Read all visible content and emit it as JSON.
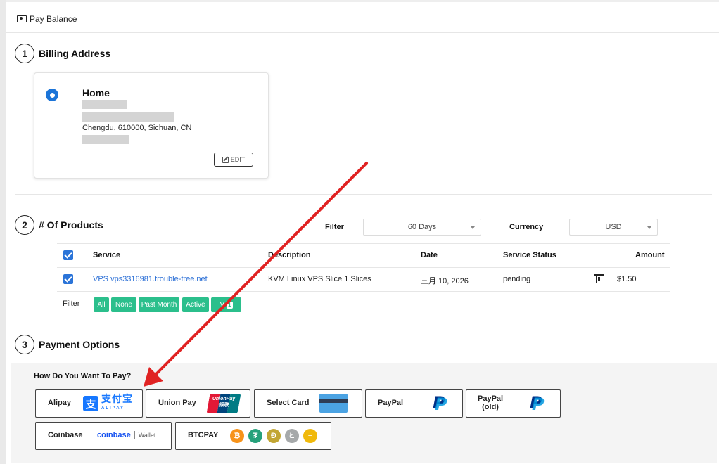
{
  "header": {
    "title": "Pay Balance",
    "icon": "money-icon"
  },
  "sections": {
    "billing": {
      "number": "1",
      "title": "Billing Address"
    },
    "products": {
      "number": "2",
      "title": "# Of Products"
    },
    "payment": {
      "number": "3",
      "title": "Payment Options"
    }
  },
  "address": {
    "name": "Home",
    "city_line": "Chengdu, 610000, Sichuan, CN",
    "edit_label": "EDIT",
    "selected": true
  },
  "filters": {
    "filter_label": "Filter",
    "filter_value": "60 Days",
    "currency_label": "Currency",
    "currency_value": "USD"
  },
  "table": {
    "columns": [
      "Service",
      "Description",
      "Date",
      "Service Status",
      "Amount"
    ],
    "rows": [
      {
        "checked": true,
        "service": "VPS vps3316981.trouble-free.net",
        "description": "KVM Linux VPS Slice 1 Slices",
        "date": "三月 10, 2026",
        "status": "pending",
        "amount": "$1.50"
      }
    ]
  },
  "row_filter": {
    "label": "Filter",
    "chips": [
      "All",
      "None",
      "Past Month",
      "Active",
      "V"
    ],
    "last_chip_badge": "1"
  },
  "payment": {
    "question": "How Do You Want To Pay?",
    "options": [
      {
        "label": "Alipay",
        "logo_cn": "支付宝",
        "logo_en": "ALIPAY"
      },
      {
        "label": "Union Pay",
        "logo_text_1": "UnionPay",
        "logo_text_2": "银联"
      },
      {
        "label": "Select Card"
      },
      {
        "label": "PayPal",
        "logo": "P"
      },
      {
        "label_line1": "PayPal",
        "label_line2": "(old)",
        "logo": "P"
      },
      {
        "label": "Coinbase",
        "logo_text": "coinbase",
        "logo_sub": "Wallet"
      },
      {
        "label": "BTCPAY",
        "coins": [
          "₿",
          "₮",
          "Ð",
          "Ł",
          "≡"
        ]
      }
    ]
  },
  "colors": {
    "accent_blue": "#2b74d8",
    "chip_green": "#2bbf8c",
    "link_blue": "#2b6fd6",
    "arrow_red": "#e02222",
    "alipay_blue": "#1677ff",
    "coin_btc": "#f7931a",
    "coin_usdt": "#26a17b",
    "coin_doge": "#c2a633",
    "coin_ltc": "#a6a9aa",
    "coin_busd": "#f0b90b"
  }
}
